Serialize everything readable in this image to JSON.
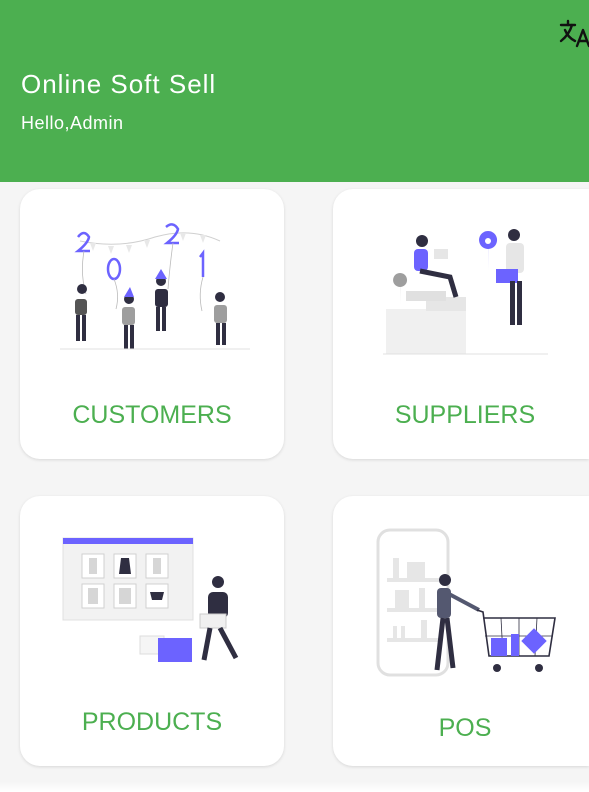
{
  "header": {
    "title": "Online Soft Sell",
    "greeting": "Hello,Admin",
    "translate_icon": "translate-icon",
    "background_color": "#4caf50"
  },
  "cards": [
    {
      "label": "CUSTOMERS",
      "illustration": "new-year-celebration-illustration"
    },
    {
      "label": "SUPPLIERS",
      "illustration": "delivery-location-illustration"
    },
    {
      "label": "PRODUCTS",
      "illustration": "clothing-store-illustration"
    },
    {
      "label": "POS",
      "illustration": "mobile-shopping-cart-illustration"
    }
  ],
  "colors": {
    "accent": "#4caf50",
    "illustration_purple": "#6c63ff",
    "illustration_dark": "#2f2e41"
  }
}
